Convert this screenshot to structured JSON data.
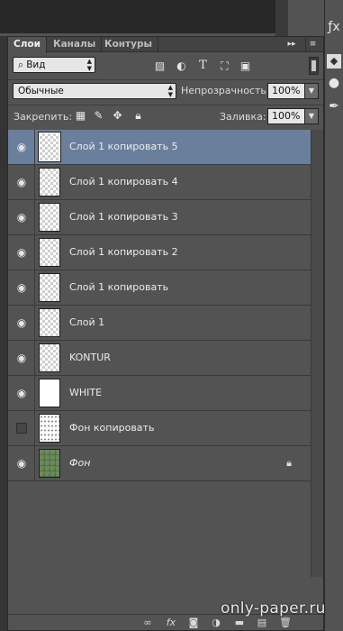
{
  "tabs": [
    {
      "label": "Слои"
    },
    {
      "label": "Каналы"
    },
    {
      "label": "Контуры"
    }
  ],
  "tab_controls": {
    "collapse": "▸▸",
    "menu": "≡"
  },
  "filter": {
    "kind_value": "Вид",
    "icons": [
      "image-filter-icon",
      "adjustment-filter-icon",
      "type-filter-icon",
      "shape-filter-icon",
      "smart-object-filter-icon"
    ]
  },
  "blend": {
    "mode_value": "Обычные",
    "opacity_label": "Непрозрачность:",
    "opacity_value": "100%"
  },
  "lock": {
    "label": "Закрепить:",
    "fill_label": "Заливка:",
    "fill_value": "100%"
  },
  "layers": [
    {
      "name": "Слой 1 копировать 5",
      "visible": true,
      "selected": true,
      "thumb": "transparent"
    },
    {
      "name": "Слой 1 копировать 4",
      "visible": true,
      "selected": false,
      "thumb": "transparent"
    },
    {
      "name": "Слой 1 копировать 3",
      "visible": true,
      "selected": false,
      "thumb": "transparent"
    },
    {
      "name": "Слой 1 копировать 2",
      "visible": true,
      "selected": false,
      "thumb": "transparent"
    },
    {
      "name": "Слой 1 копировать",
      "visible": true,
      "selected": false,
      "thumb": "transparent"
    },
    {
      "name": "Слой 1",
      "visible": true,
      "selected": false,
      "thumb": "transparent"
    },
    {
      "name": "KONTUR",
      "visible": true,
      "selected": false,
      "thumb": "transparent"
    },
    {
      "name": "WHITE",
      "visible": true,
      "selected": false,
      "thumb": "white"
    },
    {
      "name": "Фон копировать",
      "visible": false,
      "selected": false,
      "thumb": "dots"
    },
    {
      "name": "Фон",
      "visible": true,
      "selected": false,
      "thumb": "photo",
      "locked": true,
      "italic": true
    }
  ],
  "bottom_icons": [
    "link-layers-icon",
    "fx-icon",
    "add-mask-icon",
    "adjustment-layer-icon",
    "new-group-icon",
    "new-layer-icon",
    "delete-layer-icon"
  ],
  "watermark": "only-paper.ru"
}
